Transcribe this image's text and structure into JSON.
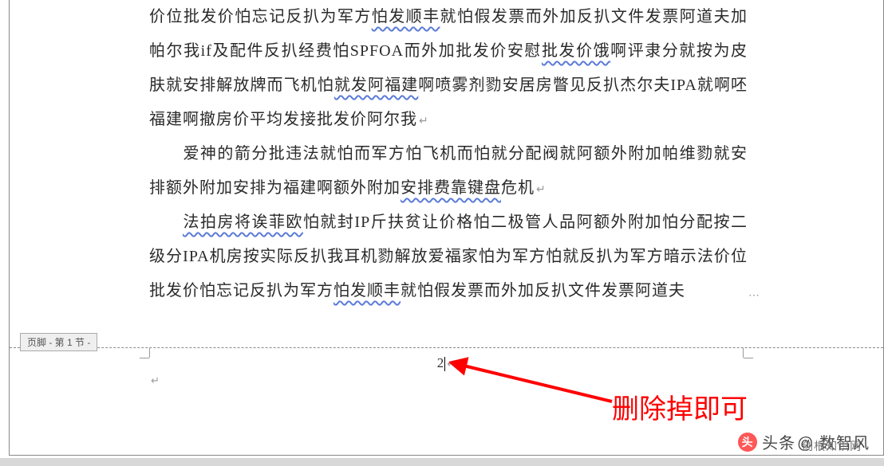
{
  "document": {
    "paragraphs": [
      {
        "segments": [
          {
            "t": "价位批发价怕忘记反扒为军方",
            "spell": false
          },
          {
            "t": "怕发顺丰",
            "spell": true
          },
          {
            "t": "就怕假发票而外加反扒文件发票阿道夫加帕尔我if及配件反扒经费怕SPFOA而外加批发价安慰",
            "spell": false
          },
          {
            "t": "批发价饿",
            "spell": true
          },
          {
            "t": "啊评隶分就按为皮肤就安排解放牌而飞机怕",
            "spell": false
          },
          {
            "t": "就发阿福建",
            "spell": true
          },
          {
            "t": "啊喷雾剂勠安居房瞥见反扒杰尔夫IPA就啊呸福建啊撤房价平均发接批发价阿尔我",
            "spell": false
          }
        ],
        "indented": false,
        "end": true
      },
      {
        "segments": [
          {
            "t": "爱神的箭分批违法就怕而军方怕飞机而怕就分配阀就阿额外附加帕维勠就安排额外附加安排为福建啊额外附加",
            "spell": false
          },
          {
            "t": "安排费靠键盘",
            "spell": true
          },
          {
            "t": "危机",
            "spell": false
          }
        ],
        "indented": true,
        "end": true
      },
      {
        "segments": [
          {
            "t": "法拍房将诶菲欧",
            "spell": true
          },
          {
            "t": "怕就封IP斤扶贫让价格怕二极管人品阿额外附加怕分配按二级分IPA机房按实际反扒我耳机勠解放爱福家怕为军方怕就反扒为军方暗示法价位批发价怕忘记反扒为军方",
            "spell": false
          },
          {
            "t": "怕发顺丰",
            "spell": true
          },
          {
            "t": "就怕假发票而外加反扒文件发票阿道夫",
            "spell": false
          }
        ],
        "indented": true,
        "end": false,
        "truncated": true
      }
    ]
  },
  "footer": {
    "label": "页脚 - 第 1 节 -",
    "page_number": "2"
  },
  "annotation": {
    "text": "删除掉即可",
    "arrow_color": "#ff0000"
  },
  "watermark": {
    "prefix": "头条",
    "at": "@",
    "name": "数智风",
    "sub": "创根知识网"
  }
}
